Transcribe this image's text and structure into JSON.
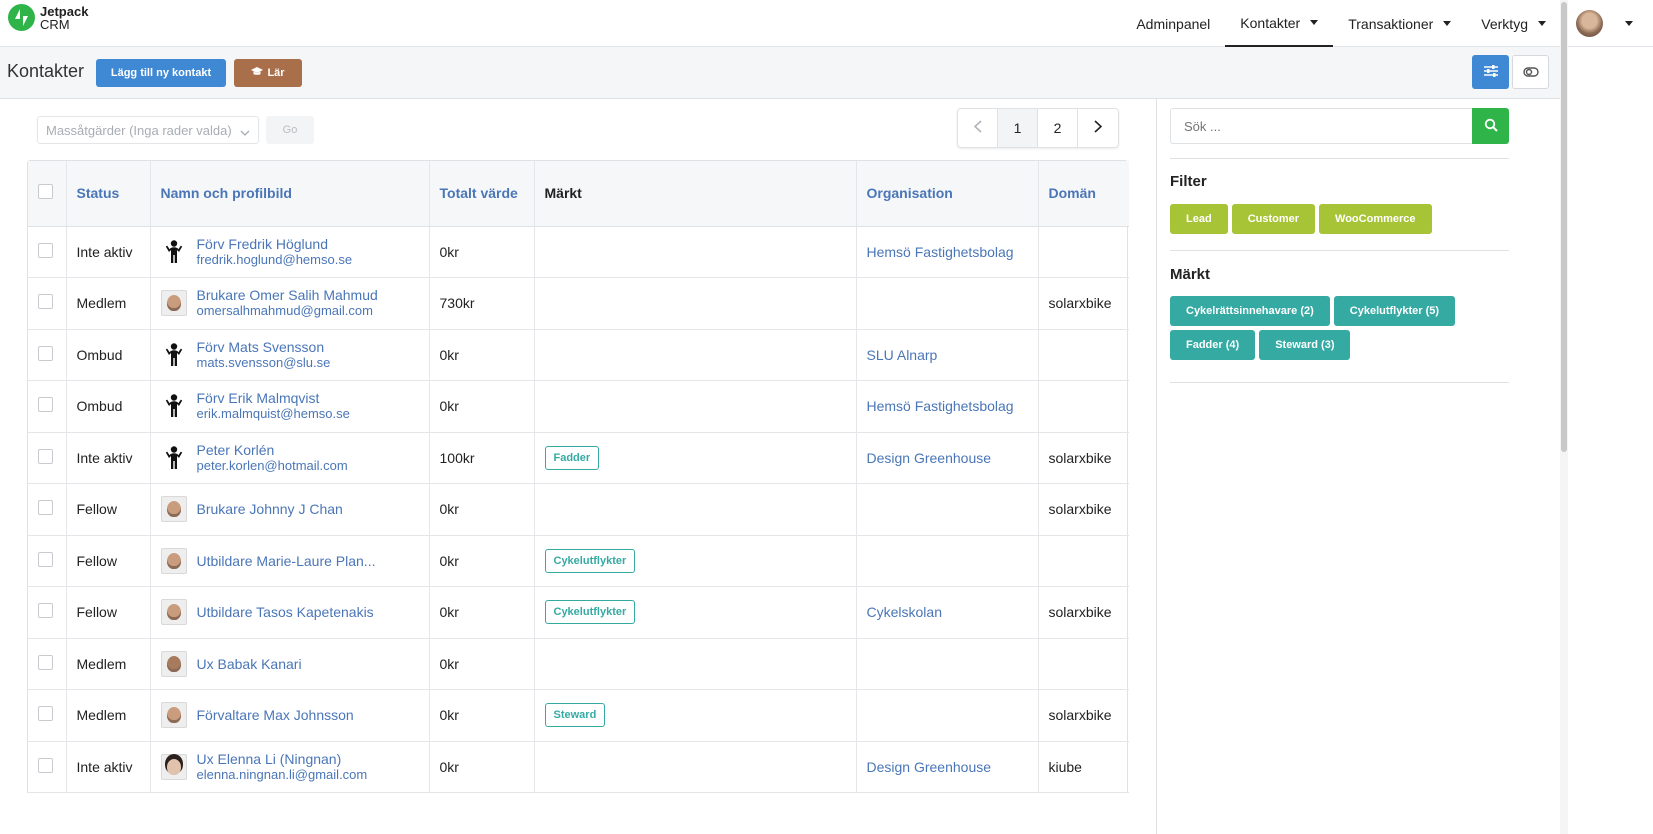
{
  "app": {
    "brand_line1": "Jetpack",
    "brand_line2": "CRM"
  },
  "nav": [
    {
      "label": "Adminpanel",
      "caret": false,
      "active": false
    },
    {
      "label": "Kontakter",
      "caret": true,
      "active": true
    },
    {
      "label": "Transaktioner",
      "caret": true,
      "active": false
    },
    {
      "label": "Verktyg",
      "caret": true,
      "active": false
    }
  ],
  "header": {
    "title": "Kontakter",
    "add_label": "Lägg till ny kontakt",
    "learn_label": "Lär"
  },
  "bulk": {
    "placeholder": "Massåtgärder (Inga rader valda)",
    "go_label": "Go"
  },
  "pagination": {
    "pages": [
      "1",
      "2"
    ],
    "current": "1"
  },
  "table": {
    "columns": [
      "Status",
      "Namn och profilbild",
      "Totalt värde",
      "Märkt",
      "Organisation",
      "Domän"
    ],
    "rows": [
      {
        "status": "Inte aktiv",
        "name": "Förv Fredrik Höglund",
        "email": "fredrik.hoglund@hemso.se",
        "avatar": "person-icon",
        "value": "0kr",
        "tag": "",
        "org": "Hemsö Fastighetsbolag",
        "domain": ""
      },
      {
        "status": "Medlem",
        "name": "Brukare Omer Salih Mahmud",
        "email": "omersalhmahmud@gmail.com",
        "avatar": "photo",
        "value": "730kr",
        "tag": "",
        "org": "",
        "domain": "solarxbike"
      },
      {
        "status": "Ombud",
        "name": "Förv Mats Svensson",
        "email": "mats.svensson@slu.se",
        "avatar": "person-icon",
        "value": "0kr",
        "tag": "",
        "org": "SLU Alnarp",
        "domain": ""
      },
      {
        "status": "Ombud",
        "name": "Förv Erik Malmqvist",
        "email": "erik.malmquist@hemso.se",
        "avatar": "person-icon",
        "value": "0kr",
        "tag": "",
        "org": "Hemsö Fastighetsbolag",
        "domain": ""
      },
      {
        "status": "Inte aktiv",
        "name": "Peter Korlén",
        "email": "peter.korlen@hotmail.com",
        "avatar": "person-icon",
        "value": "100kr",
        "tag": "Fadder",
        "org": "Design Greenhouse",
        "domain": "solarxbike"
      },
      {
        "status": "Fellow",
        "name": "Brukare Johnny J Chan",
        "email": "",
        "avatar": "photo",
        "value": "0kr",
        "tag": "",
        "org": "",
        "domain": "solarxbike"
      },
      {
        "status": "Fellow",
        "name": "Utbildare Marie-Laure Plan...",
        "email": "",
        "avatar": "photo",
        "value": "0kr",
        "tag": "Cykelutflykter",
        "org": "",
        "domain": ""
      },
      {
        "status": "Fellow",
        "name": "Utbildare Tasos Kapetenakis",
        "email": "",
        "avatar": "photo",
        "value": "0kr",
        "tag": "Cykelutflykter",
        "org": "Cykelskolan",
        "domain": "solarxbike"
      },
      {
        "status": "Medlem",
        "name": "Ux Babak Kanari",
        "email": "",
        "avatar": "photo-dark",
        "value": "0kr",
        "tag": "",
        "org": "",
        "domain": ""
      },
      {
        "status": "Medlem",
        "name": "Förvaltare Max Johnsson",
        "email": "",
        "avatar": "photo",
        "value": "0kr",
        "tag": "Steward",
        "org": "",
        "domain": "solarxbike"
      },
      {
        "status": "Inte aktiv",
        "name": "Ux Elenna Li (Ningnan)",
        "email": "elenna.ningnan.li@gmail.com",
        "avatar": "photo-woman",
        "value": "0kr",
        "tag": "",
        "org": "Design Greenhouse",
        "domain": "kiube"
      }
    ]
  },
  "sidebar": {
    "search_placeholder": "Sök ...",
    "filter_title": "Filter",
    "filters": [
      "Lead",
      "Customer",
      "WooCommerce"
    ],
    "tags_title": "Märkt",
    "tags": [
      "Cykelrättsinnehavare (2)",
      "Cykelutflykter (5)",
      "Fadder (4)",
      "Steward (3)"
    ]
  },
  "colors": {
    "brand_green": "#2fb44a",
    "primary_blue": "#3f88d4",
    "learn_brown": "#a96f4a",
    "filter_lime": "#a7c436",
    "tag_teal": "#35aaa3",
    "link": "#4a76b8"
  }
}
